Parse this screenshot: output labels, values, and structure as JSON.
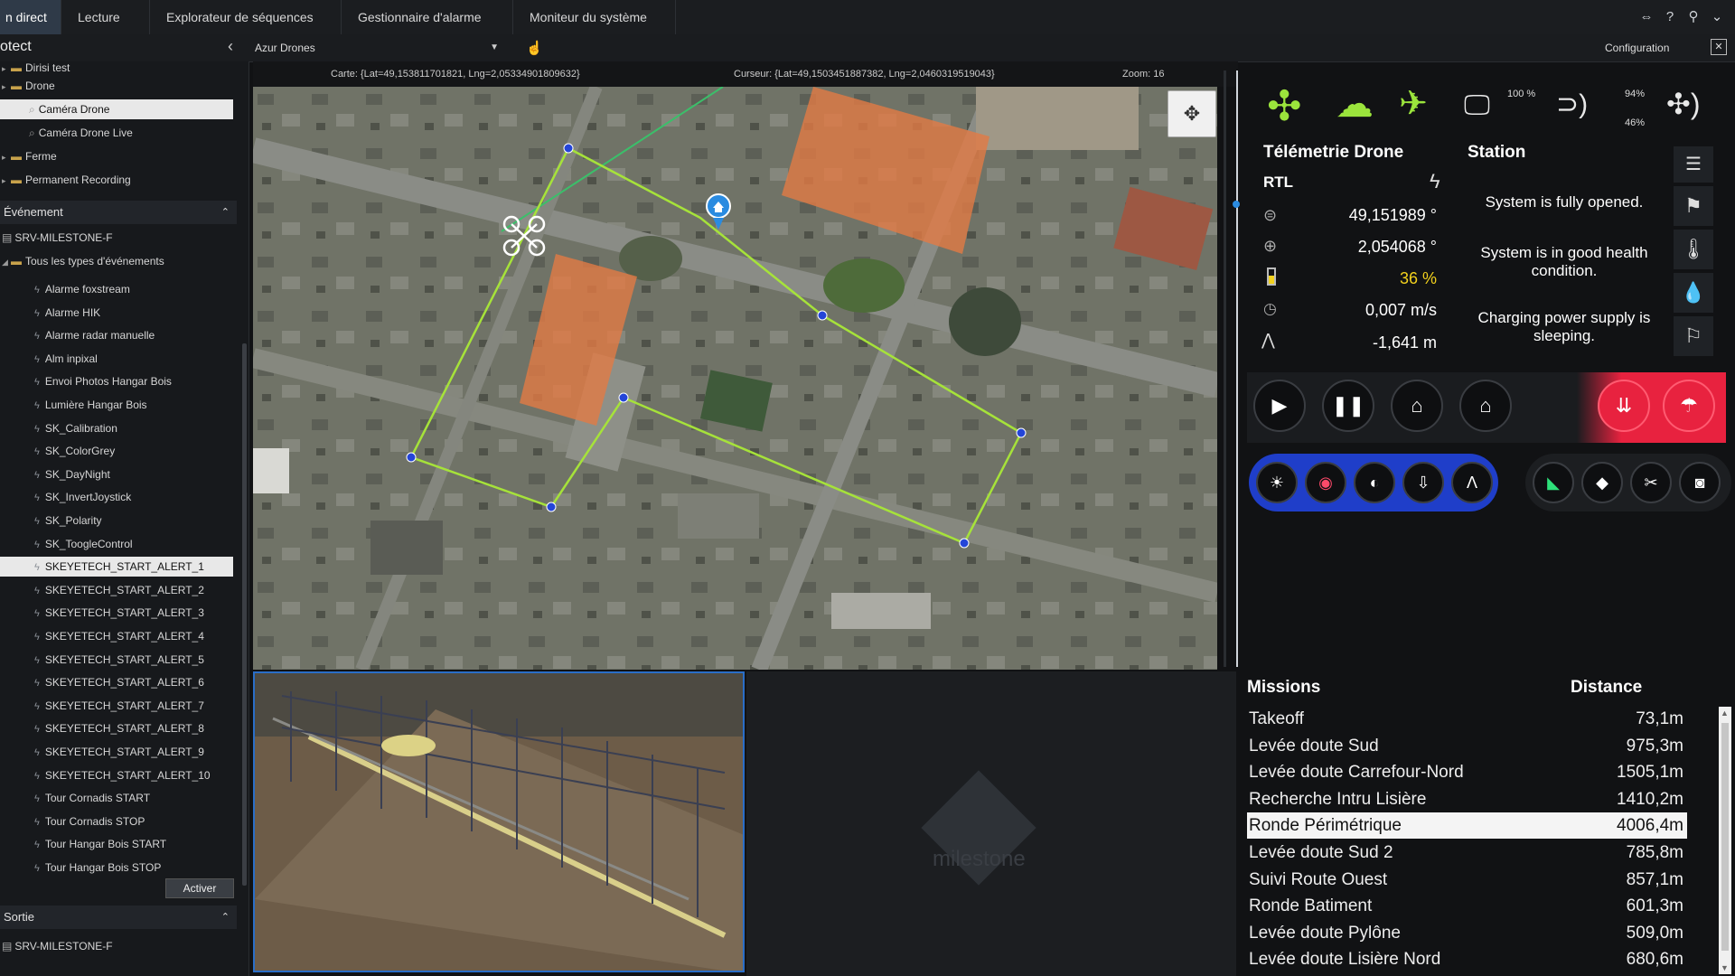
{
  "tabs": [
    "n direct",
    "Lecture",
    "Explorateur de séquences",
    "Gestionnaire d'alarme",
    "Moniteur du système"
  ],
  "bar2": {
    "panel_title": "otect",
    "view_select": "Azur Drones",
    "config": "Configuration"
  },
  "map_info": {
    "carte": "Carte: {Lat=49,153811701821, Lng=2,05334901809632}",
    "curseur": "Curseur: {Lat=49,1503451887382, Lng=2,0460319519043}",
    "zoom": "Zoom: 16"
  },
  "tree_top": [
    {
      "label": "Dirisi test",
      "type": "folder"
    },
    {
      "label": "Drone",
      "type": "folder"
    },
    {
      "label": "Caméra Drone",
      "type": "camera",
      "selected": true
    },
    {
      "label": "Caméra Drone Live",
      "type": "camera"
    },
    {
      "label": "Ferme",
      "type": "folder"
    },
    {
      "label": "Permanent Recording",
      "type": "folder"
    }
  ],
  "event_section": {
    "title": "Événement",
    "server": "SRV-MILESTONE-F",
    "all": "Tous les types d'événements"
  },
  "events": [
    "Alarme foxstream",
    "Alarme HIK",
    "Alarme radar manuelle",
    "Alm inpixal",
    "Envoi Photos Hangar Bois",
    "Lumière Hangar Bois",
    "SK_Calibration",
    "SK_ColorGrey",
    "SK_DayNight",
    "SK_InvertJoystick",
    "SK_Polarity",
    "SK_ToogleControl",
    "SKEYETECH_START_ALERT_1",
    "SKEYETECH_START_ALERT_2",
    "SKEYETECH_START_ALERT_3",
    "SKEYETECH_START_ALERT_4",
    "SKEYETECH_START_ALERT_5",
    "SKEYETECH_START_ALERT_6",
    "SKEYETECH_START_ALERT_7",
    "SKEYETECH_START_ALERT_8",
    "SKEYETECH_START_ALERT_9",
    "SKEYETECH_START_ALERT_10",
    "Tour Cornadis START",
    "Tour Cornadis STOP",
    "Tour Hangar Bois START",
    "Tour Hangar Bois STOP"
  ],
  "selected_event": "SKEYETECH_START_ALERT_1",
  "activate_label": "Activer",
  "output_section": {
    "title": "Sortie",
    "server": "SRV-MILESTONE-F"
  },
  "status_icons": {
    "battery_pct": "100 %",
    "signal_pct": "94%",
    "signal_pct2": "46%"
  },
  "telemetry": {
    "title": "Télémetrie Drone",
    "mode": "RTL",
    "lat": "49,151989 °",
    "lng": "2,054068 °",
    "battery": "36 %",
    "speed": "0,007 m/s",
    "altitude": "-1,641 m"
  },
  "station": {
    "title": "Station",
    "status1": "System is fully opened.",
    "status2": "System is in good health condition.",
    "status3": "Charging power supply is sleeping."
  },
  "missions_header": {
    "missions": "Missions",
    "distance": "Distance"
  },
  "missions": [
    {
      "name": "Takeoff",
      "dist": "73,1m"
    },
    {
      "name": "Levée doute Sud",
      "dist": "975,3m"
    },
    {
      "name": "Levée doute Carrefour-Nord",
      "dist": "1505,1m"
    },
    {
      "name": "Recherche Intru Lisière",
      "dist": "1410,2m"
    },
    {
      "name": "Ronde Périmétrique",
      "dist": "4006,4m",
      "selected": true
    },
    {
      "name": "Levée doute Sud 2",
      "dist": "785,8m"
    },
    {
      "name": "Suivi Route Ouest",
      "dist": "857,1m"
    },
    {
      "name": "Ronde Batiment",
      "dist": "601,3m"
    },
    {
      "name": "Levée doute Pylône",
      "dist": "509,0m"
    },
    {
      "name": "Levée doute Lisière Nord",
      "dist": "680,6m"
    }
  ],
  "watermark": "milestone",
  "colors": {
    "accent_green": "#9be43c",
    "route": "#a6e23a",
    "alert_red": "#e8223f",
    "blue_panel": "#1f3ec9",
    "highlight": "#f4f4f4"
  }
}
